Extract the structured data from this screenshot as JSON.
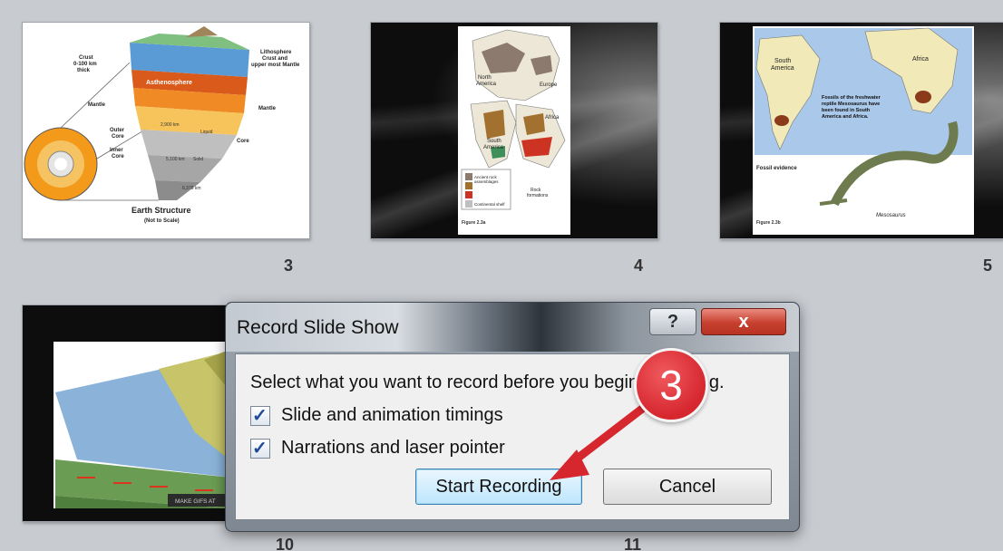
{
  "slides": [
    {
      "number": "3",
      "texts": {
        "crust": "Crust\n0-100 km\nthick",
        "lithosphere": "Lithosphere\nCrust and\nupper most Mantle",
        "asthenosphere": "Asthenosphere",
        "mantle_left": "Mantle",
        "mantle_right": "Mantle",
        "outer_core": "Outer\nCore",
        "inner_core": "Inner\nCore",
        "core": "Core",
        "d1": "2,900 km",
        "d2": "5,100 km",
        "liquid": "Liquid",
        "solid": "Solid",
        "d3": "6,378 km",
        "title": "Earth Structure",
        "subtitle": "(Not to Scale)"
      }
    },
    {
      "number": "4",
      "texts": {
        "north_america": "North\nAmerica",
        "europe": "Europe",
        "africa": "Africa",
        "south_america": "South\nAmerica",
        "legend1": "Ancient rock\nassemblages",
        "legend2": "Continental shelf",
        "rock_formations": "Rock\nformations",
        "figure": "Figure 2.3a"
      }
    },
    {
      "number": "5",
      "texts": {
        "south_america": "South\nAmerica",
        "africa": "Africa",
        "fossils_note": "Fossils of the freshwater\nreptile Mesosaurus have\nbeen found in South\nAmerica and Africa.",
        "fossil_evidence": "Fossil evidence",
        "mesosaurus": "Mesosaurus",
        "figure": "Figure 2.3b"
      }
    },
    {
      "number": "10",
      "texts": {
        "watermark": "MAKE GIFS AT"
      }
    }
  ],
  "next_slide_number": "11",
  "dialog": {
    "title": "Record Slide Show",
    "help_label": "?",
    "close_label": "x",
    "prompt": "Select what you want to record before you begin recording.",
    "options": [
      {
        "label": "Slide and animation timings",
        "checked": true
      },
      {
        "label": "Narrations and laser pointer",
        "checked": true
      }
    ],
    "check_mark": "✓",
    "start_button": "Start Recording",
    "cancel_button": "Cancel"
  },
  "annotation": {
    "step_number": "3",
    "color": "#d6262e"
  }
}
